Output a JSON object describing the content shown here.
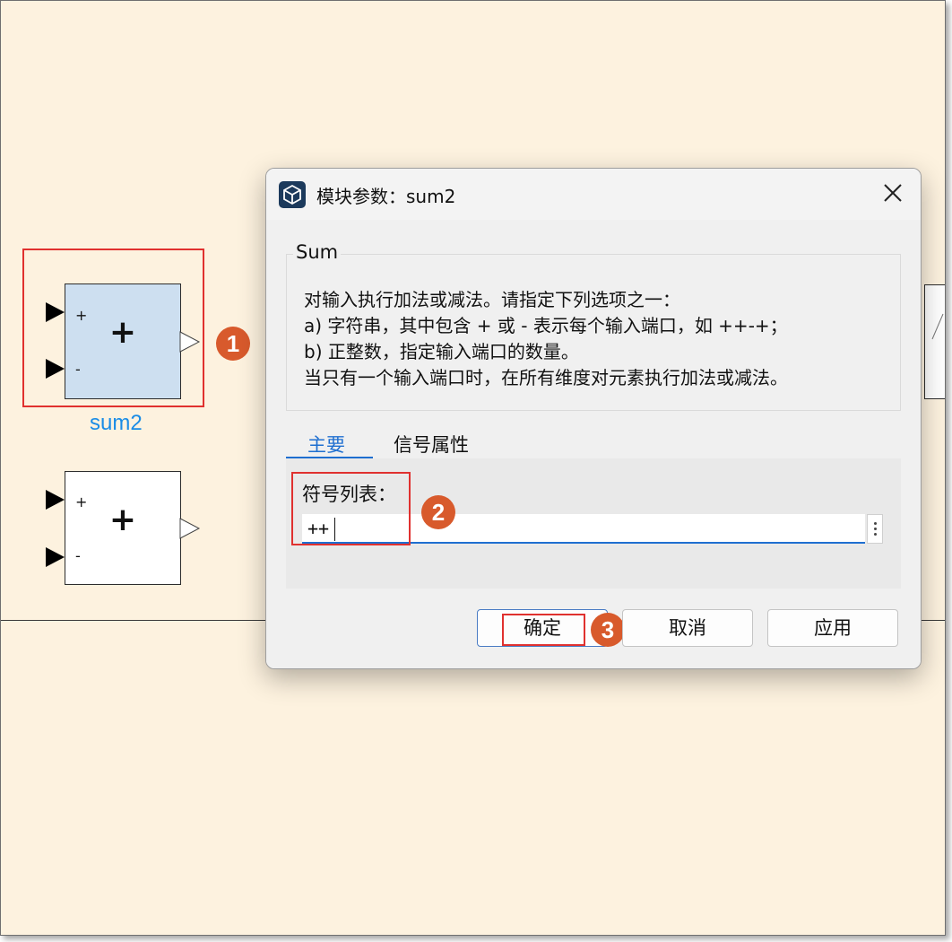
{
  "canvas": {
    "block_selected": {
      "name_label": "sum2",
      "symbol": "+",
      "signs": [
        "+",
        "-"
      ]
    },
    "block_other": {
      "symbol": "+",
      "signs": [
        "+",
        "-"
      ]
    }
  },
  "markers": [
    "1",
    "2",
    "3"
  ],
  "dialog": {
    "title": "模块参数：sum2",
    "close_icon": "close-icon",
    "group_title": "Sum",
    "description": [
      "对输入执行加法或减法。请指定下列选项之一：",
      "a) 字符串，其中包含 + 或 - 表示每个输入端口，如 ++-+；",
      "b) 正整数，指定输入端口的数量。",
      "当只有一个输入端口时，在所有维度对元素执行加法或减法。"
    ],
    "tabs": [
      {
        "label": "主要",
        "active": true
      },
      {
        "label": "信号属性",
        "active": false
      }
    ],
    "field_label": "符号列表：",
    "field_value": "++",
    "buttons": {
      "ok": "确定",
      "cancel": "取消",
      "apply": "应用"
    }
  },
  "colors": {
    "canvas_bg": "#fdf2df",
    "highlight_red": "#e0312f",
    "marker_orange": "#d85a2c",
    "selected_block": "#cddff0",
    "accent_blue": "#1f6fd0",
    "label_blue": "#1a8ce6"
  }
}
